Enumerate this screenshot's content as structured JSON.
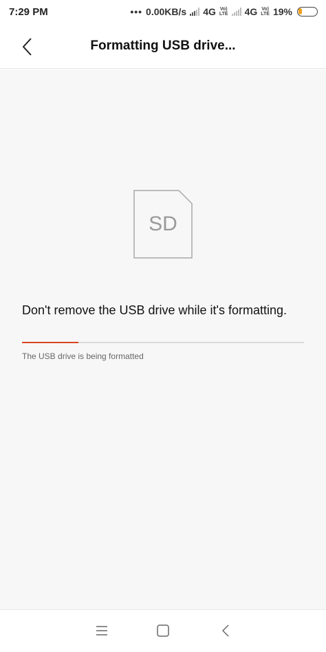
{
  "status_bar": {
    "time": "7:29 PM",
    "dots": "•••",
    "speed": "0.00KB/s",
    "network1": "4G",
    "network2": "4G",
    "volte_top": "Vo)",
    "volte_bottom": "LTE",
    "battery_percent": "19%",
    "battery_level": 0.19,
    "battery_color": "#f0a21a"
  },
  "header": {
    "title": "Formatting USB drive..."
  },
  "content": {
    "sd_icon_label": "SD",
    "warning": "Don't remove the USB drive while it's formatting.",
    "progress": 0.2,
    "progress_color": "#d9451f",
    "status": "The USB drive is being formatted"
  },
  "icons": {
    "back": "back-arrow-icon",
    "menu": "menu-icon",
    "home": "home-icon",
    "nav_back": "nav-back-icon"
  }
}
